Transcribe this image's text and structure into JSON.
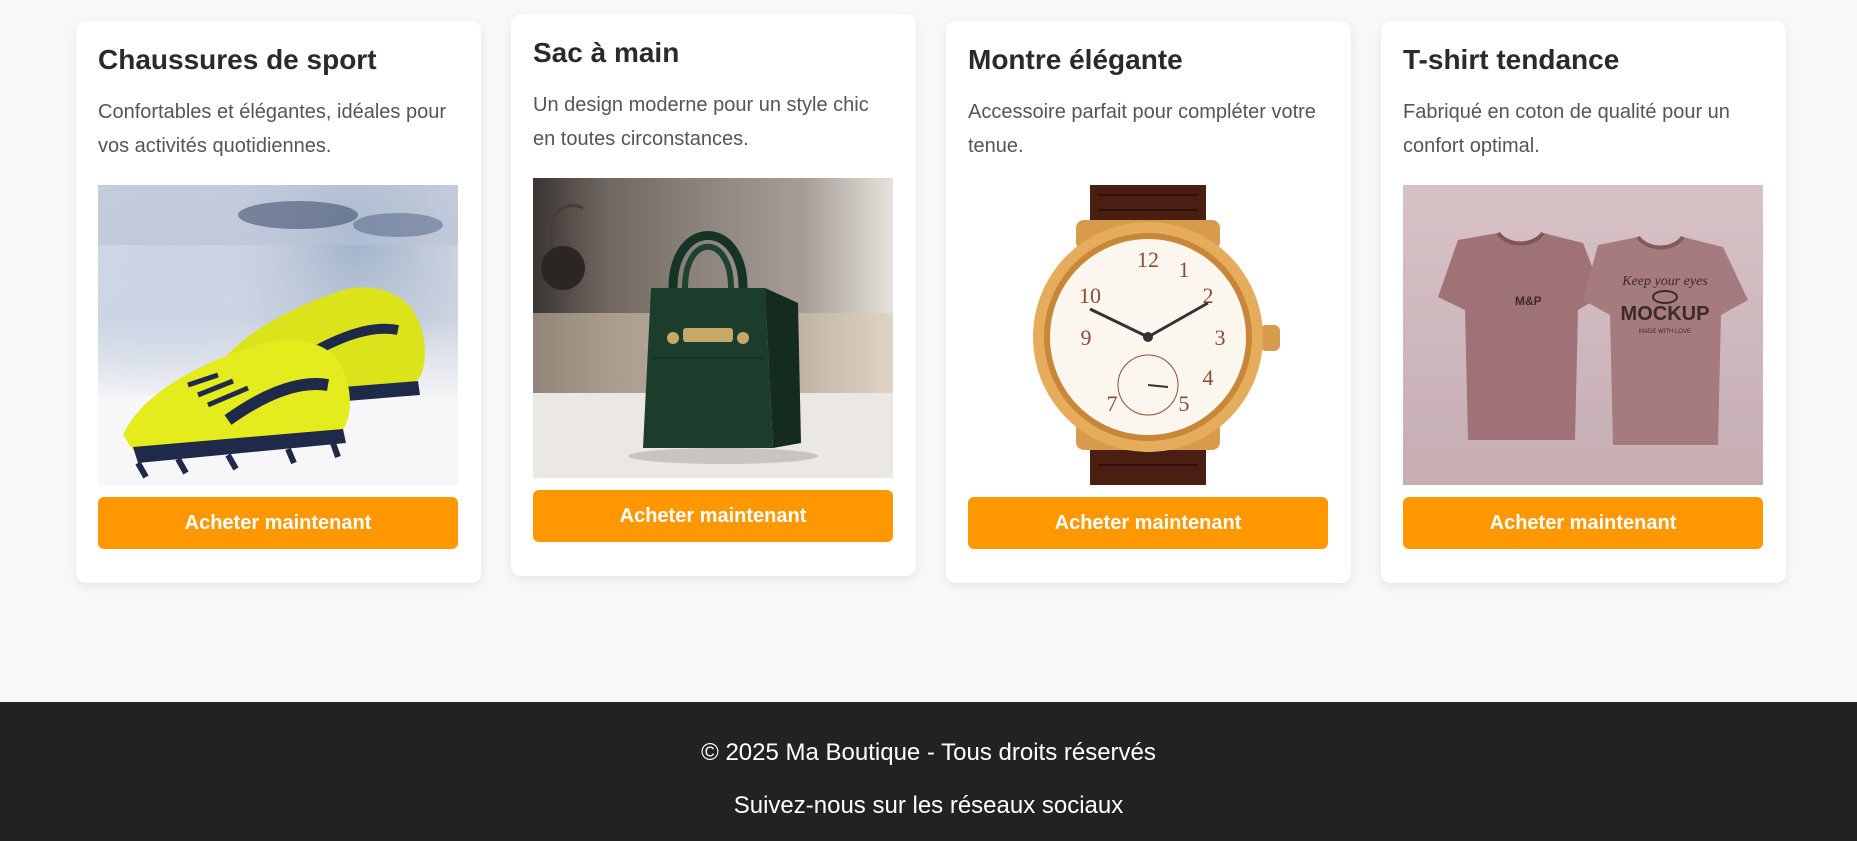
{
  "products": [
    {
      "title": "Chaussures de sport",
      "description": "Confortables et élégantes, idéales pour vos activités quotidiennes.",
      "image": "sport-shoes-photo",
      "button": "Acheter maintenant"
    },
    {
      "title": "Sac à main",
      "description": "Un design moderne pour un style chic en toutes circonstances.",
      "image": "handbag-photo",
      "button": "Acheter maintenant"
    },
    {
      "title": "Montre élégante",
      "description": "Accessoire parfait pour compléter votre tenue.",
      "image": "watch-photo",
      "button": "Acheter maintenant"
    },
    {
      "title": "T-shirt tendance",
      "description": "Fabriqué en coton de qualité pour un confort optimal.",
      "image": "tshirt-photo",
      "button": "Acheter maintenant"
    }
  ],
  "footer": {
    "copyright": "© 2025 Ma Boutique - Tous droits réservés",
    "social": "Suivez-nous sur les réseaux sociaux"
  },
  "colors": {
    "accent": "#ff9800",
    "footer_bg": "#222222",
    "page_bg": "#f8f8f8"
  }
}
